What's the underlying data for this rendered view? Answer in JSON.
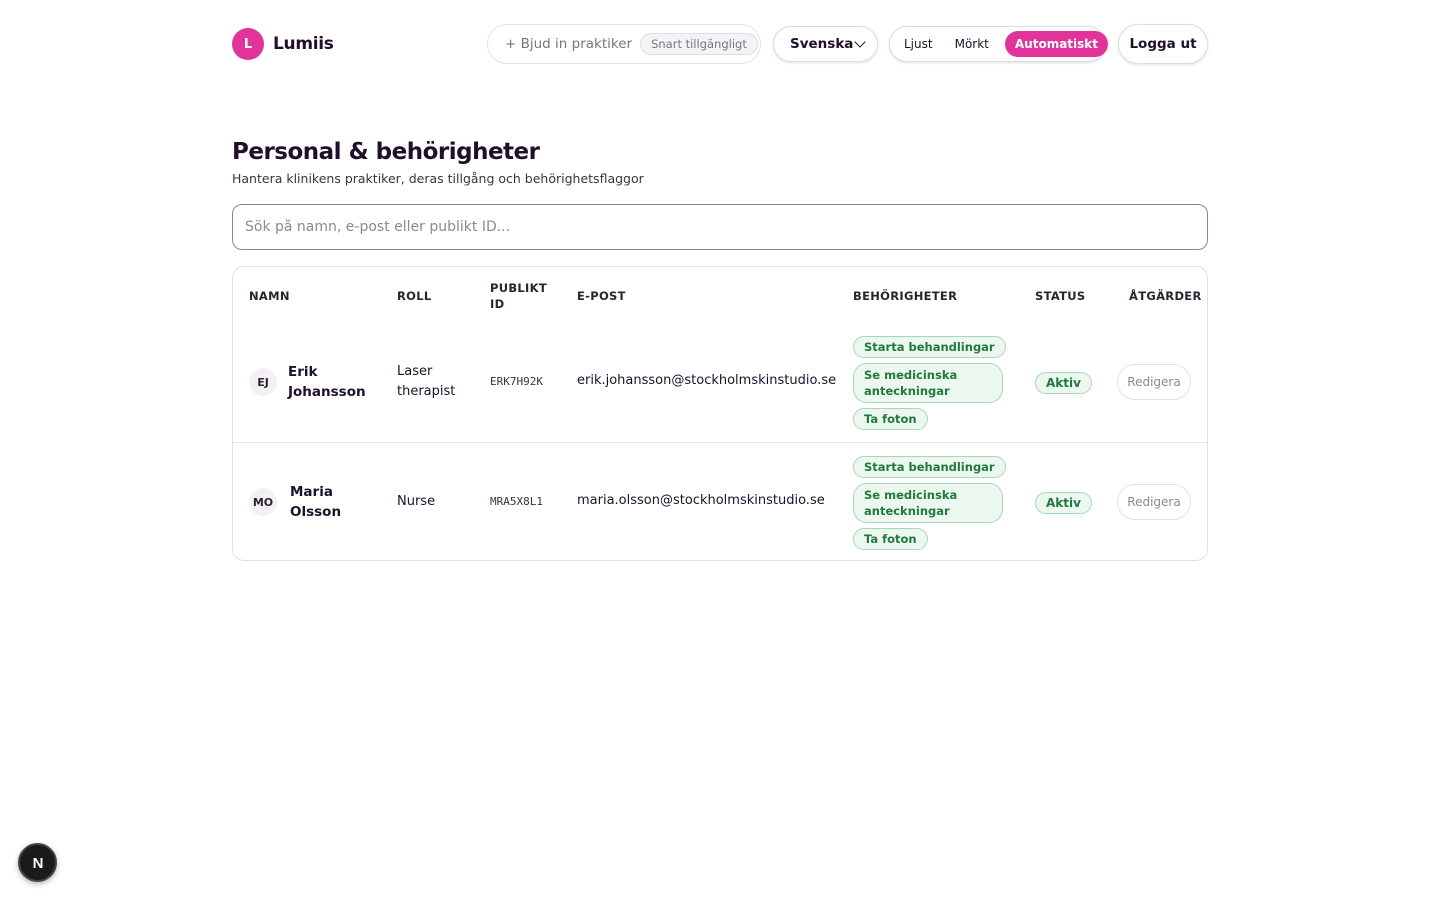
{
  "brand": {
    "initial": "L",
    "name": "Lumiis"
  },
  "header": {
    "invite_label": "+ Bjud in praktiker",
    "invite_badge": "Snart tillgängligt",
    "language": "Svenska",
    "theme_options": [
      "Ljust",
      "Mörkt",
      "Automatiskt"
    ],
    "theme_selected": "Automatiskt",
    "logout_label": "Logga ut"
  },
  "page": {
    "title": "Personal & behörigheter",
    "subtitle": "Hantera klinikens praktiker, deras tillgång och behörighetsflaggor"
  },
  "search": {
    "placeholder": "Sök på namn, e-post eller publikt ID..."
  },
  "table": {
    "headers": {
      "name": "NAMN",
      "role": "ROLL",
      "public_id_1": "PUBLIKT",
      "public_id_2": "ID",
      "email": "E-POST",
      "permissions": "BEHÖRIGHETER",
      "status": "STATUS",
      "actions": "ÅTGÄRDER"
    },
    "rows": [
      {
        "initials": "EJ",
        "first_name": "Erik",
        "last_name": "Johansson",
        "role_1": "Laser",
        "role_2": "therapist",
        "public_id": "ERK7H92K",
        "email": "erik.johansson@stockholmskinstudio.se",
        "perm_1": "Starta behandlingar",
        "perm_2a": "Se medicinska",
        "perm_2b": "anteckningar",
        "perm_3": "Ta foton",
        "status": "Aktiv",
        "action": "Redigera"
      },
      {
        "initials": "MO",
        "first_name": "Maria",
        "last_name": "Olsson",
        "role_1": "Nurse",
        "role_2": "",
        "public_id": "MRA5X8L1",
        "email": "maria.olsson@stockholmskinstudio.se",
        "perm_1": "Starta behandlingar",
        "perm_2a": "Se medicinska",
        "perm_2b": "anteckningar",
        "perm_3": "Ta foton",
        "status": "Aktiv",
        "action": "Redigera"
      }
    ]
  },
  "dev_badge": {
    "letter": "N"
  }
}
